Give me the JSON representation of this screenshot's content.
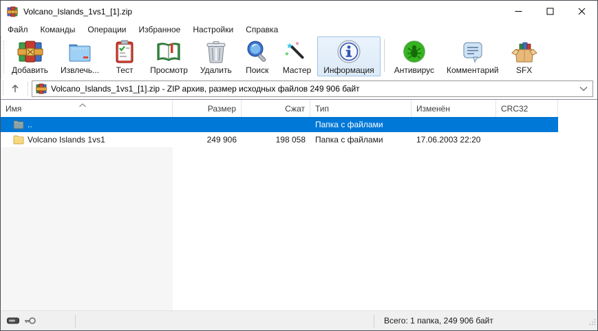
{
  "window": {
    "title": "Volcano_Islands_1vs1_[1].zip",
    "controls": {
      "minimize": "minimize",
      "maximize": "maximize",
      "close": "close"
    }
  },
  "menu": {
    "items": [
      "Файл",
      "Команды",
      "Операции",
      "Избранное",
      "Настройки",
      "Справка"
    ]
  },
  "toolbar": {
    "buttons": [
      {
        "label": "Добавить",
        "icon": "add-archive-icon"
      },
      {
        "label": "Извлечь...",
        "icon": "extract-folder-icon"
      },
      {
        "label": "Тест",
        "icon": "test-clipboard-icon"
      },
      {
        "label": "Просмотр",
        "icon": "view-book-icon"
      },
      {
        "label": "Удалить",
        "icon": "delete-trash-icon"
      },
      {
        "label": "Поиск",
        "icon": "search-magnifier-icon"
      },
      {
        "label": "Мастер",
        "icon": "wizard-wand-icon"
      },
      {
        "label": "Информация",
        "icon": "info-circle-icon"
      },
      {
        "label": "Антивирус",
        "icon": "antivirus-bug-icon"
      },
      {
        "label": "Комментарий",
        "icon": "comment-bubble-icon"
      },
      {
        "label": "SFX",
        "icon": "sfx-box-icon"
      }
    ],
    "active_button": "Информация"
  },
  "addressbar": {
    "text": "Volcano_Islands_1vs1_[1].zip - ZIP архив, размер исходных файлов 249 906 байт"
  },
  "table": {
    "columns": [
      "Имя",
      "Размер",
      "Сжат",
      "Тип",
      "Изменён",
      "CRC32"
    ],
    "sorted_column": "Имя",
    "sort_direction": "ascending",
    "rows": [
      {
        "name": "..",
        "size": "",
        "packed": "",
        "type": "Папка с файлами",
        "modified": "",
        "crc32": "",
        "selected": true,
        "icon": "folder-up-icon"
      },
      {
        "name": "Volcano Islands 1vs1",
        "size": "249 906",
        "packed": "198 058",
        "type": "Папка с файлами",
        "modified": "17.06.2003 22:20",
        "crc32": "",
        "selected": false,
        "icon": "folder-icon"
      }
    ]
  },
  "statusbar": {
    "total": "Всего: 1 папка, 249 906 байт"
  },
  "colors": {
    "selection": "#0078d7",
    "selection_text": "#ffffff",
    "active_button_bg": "#dcebf8",
    "active_button_border": "#9cc3e6",
    "name_column_shade": "#f6f6f7"
  }
}
